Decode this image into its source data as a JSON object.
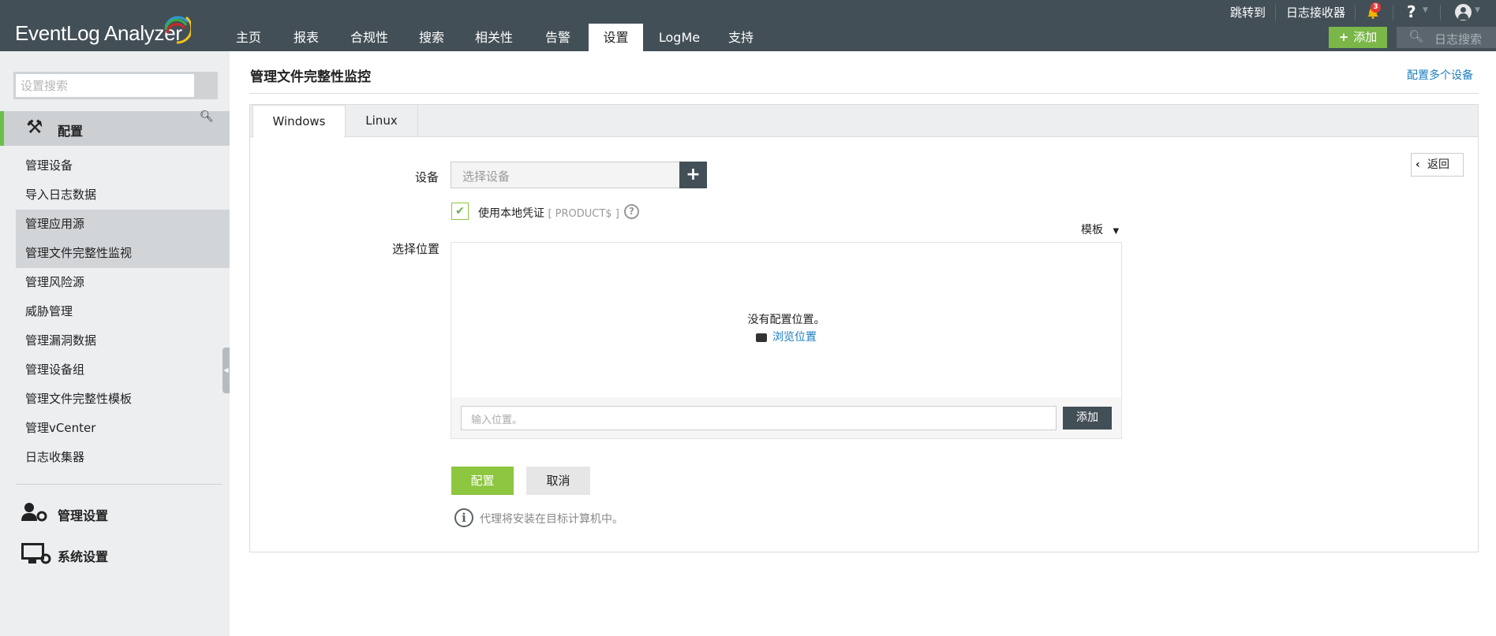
{
  "header": {
    "logo": "EventLog Analyzer",
    "nav": [
      {
        "label": "主页"
      },
      {
        "label": "报表"
      },
      {
        "label": "合规性"
      },
      {
        "label": "搜索"
      },
      {
        "label": "相关性"
      },
      {
        "label": "告警"
      },
      {
        "label": "设置",
        "active": true
      },
      {
        "label": "LogMe"
      },
      {
        "label": "支持"
      }
    ],
    "jump_to": "跳转到",
    "log_receiver": "日志接收器",
    "notification_count": "3",
    "help": "?",
    "add_label": "添加",
    "log_search_placeholder": "日志搜索"
  },
  "sidebar": {
    "search_placeholder": "设置搜索",
    "section_title": "配置",
    "items": [
      {
        "label": "管理设备"
      },
      {
        "label": "导入日志数据"
      },
      {
        "label": "管理应用源"
      },
      {
        "label": "管理文件完整性监视"
      },
      {
        "label": "管理风险源"
      },
      {
        "label": "威胁管理"
      },
      {
        "label": "管理漏洞数据"
      },
      {
        "label": "管理设备组"
      },
      {
        "label": "管理文件完整性模板"
      },
      {
        "label": "管理vCenter"
      },
      {
        "label": "日志收集器"
      }
    ],
    "admin_settings": "管理设置",
    "system_settings": "系统设置"
  },
  "main": {
    "title": "管理文件完整性监控",
    "configure_multiple": "配置多个设备",
    "tabs": [
      {
        "label": "Windows"
      },
      {
        "label": "Linux"
      }
    ],
    "back": "返回",
    "device_label": "设备",
    "device_placeholder": "选择设备",
    "use_local_cred": "使用本地凭证",
    "cred_tag": "[ PRODUCT$ ]",
    "template": "模板",
    "location_label": "选择位置",
    "no_location": "没有配置位置。",
    "browse": "浏览位置",
    "location_placeholder": "输入位置。",
    "add": "添加",
    "configure": "配置",
    "cancel": "取消",
    "info": "代理将安装在目标计算机中。"
  },
  "colors": {
    "header": "#434f57",
    "green": "#8dc63f",
    "link": "#1a7dc2"
  }
}
